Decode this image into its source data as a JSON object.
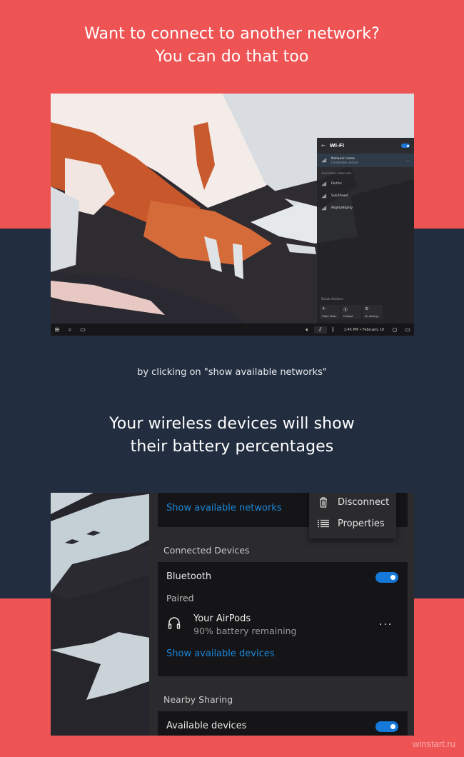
{
  "headline_top": {
    "line1": "Want to connect to another network?",
    "line2": "You can do that too"
  },
  "caption": "by clicking on \"show available networks\"",
  "headline_bottom": {
    "line1": "Your wireless devices will show",
    "line2": "their battery percentages"
  },
  "watermark": "winstart.ru",
  "colors": {
    "background_red": "#ef5455",
    "background_navy": "#222e40",
    "accent_blue": "#1479d9",
    "link_blue": "#1c86d8"
  },
  "screenshot1": {
    "wifi_flyout": {
      "back_icon": "arrow-left-icon",
      "title": "Wi-Fi",
      "toggle_on": true,
      "current_network": {
        "name": "Network name",
        "status": "Connected, secure",
        "more": "..."
      },
      "available_label": "Available networks",
      "networks": [
        {
          "name": "PortAir",
          "icon": "wifi-icon"
        },
        {
          "name": "Sub2Pewd",
          "icon": "wifi-icon"
        },
        {
          "name": "MightyNighty",
          "icon": "wifi-icon"
        }
      ],
      "quick_actions_label": "Quick Actions",
      "quick_actions": [
        {
          "label": "Flight Mode",
          "icon": "airplane-icon"
        },
        {
          "label": "Hotspot",
          "icon": "hotspot-icon"
        },
        {
          "label": "All settings",
          "icon": "gear-icon"
        }
      ]
    },
    "taskbar": {
      "left_icons": [
        "windows-start-icon",
        "search-icon",
        "task-view-icon"
      ],
      "tray_icons": [
        "volume-icon",
        "wifi-icon",
        "bluetooth-icon"
      ],
      "clock": "1:45 PM  •  February 10",
      "right_icons": [
        "cortana-circle-icon",
        "notification-icon"
      ]
    }
  },
  "screenshot2": {
    "show_networks_link": "Show available networks",
    "context_menu": [
      {
        "label": "Disconnect",
        "icon": "trash-icon"
      },
      {
        "label": "Properties",
        "icon": "list-icon"
      }
    ],
    "connected_devices_label": "Connected Devices",
    "bluetooth": {
      "label": "Bluetooth",
      "toggle_on": true,
      "paired_label": "Paired",
      "device": {
        "name": "Your AirPods",
        "battery": "90% battery remaining",
        "battery_percent": 90,
        "icon": "headphones-icon",
        "more": "..."
      },
      "show_devices_link": "Show available devices"
    },
    "nearby_sharing_label": "Nearby Sharing",
    "nearby": {
      "label": "Available devices",
      "toggle_on": true
    }
  }
}
